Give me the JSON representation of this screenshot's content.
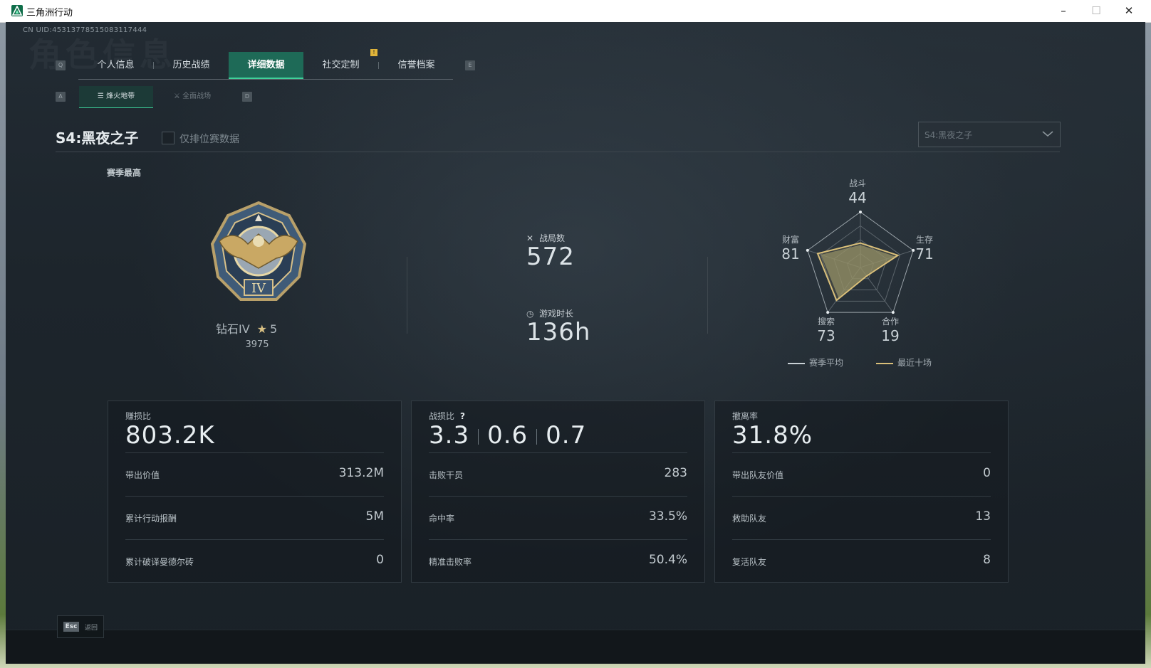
{
  "window": {
    "title": "三角洲行动",
    "min": "–",
    "max": "☐",
    "close": "✕"
  },
  "uid": "CN UID:453137785150831174​44",
  "bg_text": "角色信息",
  "keys": {
    "prev_tab": "Q",
    "next_tab": "E",
    "prev_sub": "A",
    "next_sub": "D"
  },
  "tabs": [
    {
      "label": "个人信息"
    },
    {
      "label": "历史战绩"
    },
    {
      "label": "详细数据"
    },
    {
      "label": "社交定制"
    },
    {
      "label": "信誉档案"
    }
  ],
  "tab_notification": "!",
  "subtabs": [
    {
      "label": "烽火地带",
      "icon": "flame-icon"
    },
    {
      "label": "全面战场",
      "icon": "battlefield-icon"
    }
  ],
  "season": {
    "title": "S4:黑夜之子",
    "ranked_only_label": "仅排位赛数据",
    "select_value": "S4:黑夜之子"
  },
  "best": {
    "label": "赛季最高",
    "rank": "钻石IV",
    "stars": "5",
    "score": "3975",
    "badge_numeral": "IV"
  },
  "summary": {
    "matches_label": "战局数",
    "matches": "572",
    "playtime_label": "游戏时长",
    "playtime": "136h"
  },
  "radar": {
    "axes": [
      {
        "label": "战斗",
        "value": "44"
      },
      {
        "label": "生存",
        "value": "71"
      },
      {
        "label": "合作",
        "value": "19"
      },
      {
        "label": "搜索",
        "value": "73"
      },
      {
        "label": "财富",
        "value": "81"
      }
    ],
    "legend": [
      {
        "label": "赛季平均",
        "color": "#c9d1d6"
      },
      {
        "label": "最近十场",
        "color": "#d9bf79"
      }
    ],
    "colors": {
      "season_avg": "#8b8a63",
      "recent": "#d9bf79"
    }
  },
  "cards": {
    "profit": {
      "label": "赚损比",
      "value": "803.2K",
      "rows": [
        {
          "k": "带出价值",
          "v": "313.2M"
        },
        {
          "k": "累计行动报酬",
          "v": "5M"
        },
        {
          "k": "累计破译曼德尔砖",
          "v": "0"
        }
      ]
    },
    "kd": {
      "label": "战损比",
      "help": "?",
      "values": [
        "3.3",
        "0.6",
        "0.7"
      ],
      "rows": [
        {
          "k": "击败干员",
          "v": "283"
        },
        {
          "k": "命中率",
          "v": "33.5%"
        },
        {
          "k": "精准击败率",
          "v": "50.4%"
        }
      ]
    },
    "extract": {
      "label": "撤离率",
      "value": "31.8%",
      "rows": [
        {
          "k": "带出队友价值",
          "v": "0"
        },
        {
          "k": "救助队友",
          "v": "13"
        },
        {
          "k": "复活队友",
          "v": "8"
        }
      ]
    }
  },
  "footer": {
    "esc_key": "Esc",
    "esc_label": "返回"
  },
  "accent": "#3fd19a"
}
